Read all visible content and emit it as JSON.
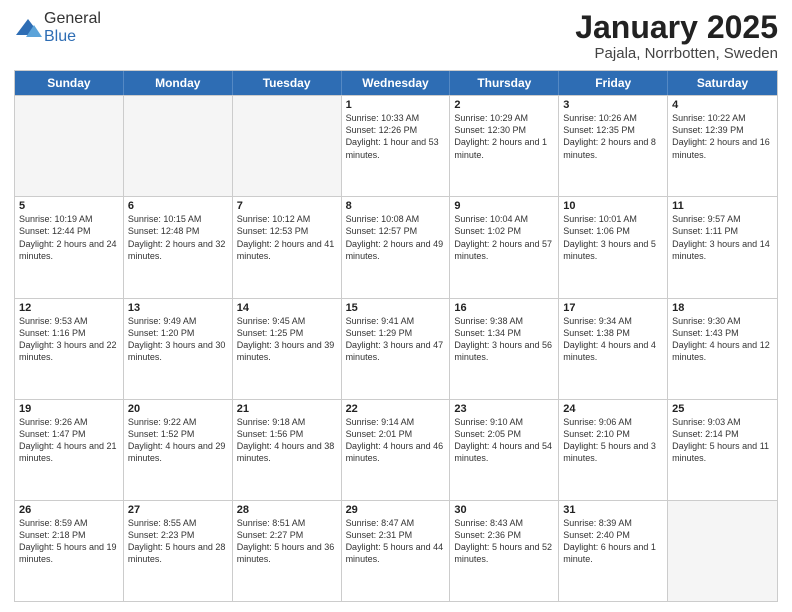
{
  "header": {
    "logo_general": "General",
    "logo_blue": "Blue",
    "month_title": "January 2025",
    "location": "Pajala, Norrbotten, Sweden"
  },
  "weekdays": [
    "Sunday",
    "Monday",
    "Tuesday",
    "Wednesday",
    "Thursday",
    "Friday",
    "Saturday"
  ],
  "weeks": [
    [
      {
        "day": "",
        "empty": true
      },
      {
        "day": "",
        "empty": true
      },
      {
        "day": "",
        "empty": true
      },
      {
        "day": "1",
        "info": "Sunrise: 10:33 AM\nSunset: 12:26 PM\nDaylight: 1 hour and\n53 minutes."
      },
      {
        "day": "2",
        "info": "Sunrise: 10:29 AM\nSunset: 12:30 PM\nDaylight: 2 hours\nand 1 minute."
      },
      {
        "day": "3",
        "info": "Sunrise: 10:26 AM\nSunset: 12:35 PM\nDaylight: 2 hours\nand 8 minutes."
      },
      {
        "day": "4",
        "info": "Sunrise: 10:22 AM\nSunset: 12:39 PM\nDaylight: 2 hours\nand 16 minutes."
      }
    ],
    [
      {
        "day": "5",
        "info": "Sunrise: 10:19 AM\nSunset: 12:44 PM\nDaylight: 2 hours\nand 24 minutes."
      },
      {
        "day": "6",
        "info": "Sunrise: 10:15 AM\nSunset: 12:48 PM\nDaylight: 2 hours\nand 32 minutes."
      },
      {
        "day": "7",
        "info": "Sunrise: 10:12 AM\nSunset: 12:53 PM\nDaylight: 2 hours\nand 41 minutes."
      },
      {
        "day": "8",
        "info": "Sunrise: 10:08 AM\nSunset: 12:57 PM\nDaylight: 2 hours\nand 49 minutes."
      },
      {
        "day": "9",
        "info": "Sunrise: 10:04 AM\nSunset: 1:02 PM\nDaylight: 2 hours\nand 57 minutes."
      },
      {
        "day": "10",
        "info": "Sunrise: 10:01 AM\nSunset: 1:06 PM\nDaylight: 3 hours\nand 5 minutes."
      },
      {
        "day": "11",
        "info": "Sunrise: 9:57 AM\nSunset: 1:11 PM\nDaylight: 3 hours\nand 14 minutes."
      }
    ],
    [
      {
        "day": "12",
        "info": "Sunrise: 9:53 AM\nSunset: 1:16 PM\nDaylight: 3 hours\nand 22 minutes."
      },
      {
        "day": "13",
        "info": "Sunrise: 9:49 AM\nSunset: 1:20 PM\nDaylight: 3 hours\nand 30 minutes."
      },
      {
        "day": "14",
        "info": "Sunrise: 9:45 AM\nSunset: 1:25 PM\nDaylight: 3 hours\nand 39 minutes."
      },
      {
        "day": "15",
        "info": "Sunrise: 9:41 AM\nSunset: 1:29 PM\nDaylight: 3 hours\nand 47 minutes."
      },
      {
        "day": "16",
        "info": "Sunrise: 9:38 AM\nSunset: 1:34 PM\nDaylight: 3 hours\nand 56 minutes."
      },
      {
        "day": "17",
        "info": "Sunrise: 9:34 AM\nSunset: 1:38 PM\nDaylight: 4 hours\nand 4 minutes."
      },
      {
        "day": "18",
        "info": "Sunrise: 9:30 AM\nSunset: 1:43 PM\nDaylight: 4 hours\nand 12 minutes."
      }
    ],
    [
      {
        "day": "19",
        "info": "Sunrise: 9:26 AM\nSunset: 1:47 PM\nDaylight: 4 hours\nand 21 minutes."
      },
      {
        "day": "20",
        "info": "Sunrise: 9:22 AM\nSunset: 1:52 PM\nDaylight: 4 hours\nand 29 minutes."
      },
      {
        "day": "21",
        "info": "Sunrise: 9:18 AM\nSunset: 1:56 PM\nDaylight: 4 hours\nand 38 minutes."
      },
      {
        "day": "22",
        "info": "Sunrise: 9:14 AM\nSunset: 2:01 PM\nDaylight: 4 hours\nand 46 minutes."
      },
      {
        "day": "23",
        "info": "Sunrise: 9:10 AM\nSunset: 2:05 PM\nDaylight: 4 hours\nand 54 minutes."
      },
      {
        "day": "24",
        "info": "Sunrise: 9:06 AM\nSunset: 2:10 PM\nDaylight: 5 hours\nand 3 minutes."
      },
      {
        "day": "25",
        "info": "Sunrise: 9:03 AM\nSunset: 2:14 PM\nDaylight: 5 hours\nand 11 minutes."
      }
    ],
    [
      {
        "day": "26",
        "info": "Sunrise: 8:59 AM\nSunset: 2:18 PM\nDaylight: 5 hours\nand 19 minutes."
      },
      {
        "day": "27",
        "info": "Sunrise: 8:55 AM\nSunset: 2:23 PM\nDaylight: 5 hours\nand 28 minutes."
      },
      {
        "day": "28",
        "info": "Sunrise: 8:51 AM\nSunset: 2:27 PM\nDaylight: 5 hours\nand 36 minutes."
      },
      {
        "day": "29",
        "info": "Sunrise: 8:47 AM\nSunset: 2:31 PM\nDaylight: 5 hours\nand 44 minutes."
      },
      {
        "day": "30",
        "info": "Sunrise: 8:43 AM\nSunset: 2:36 PM\nDaylight: 5 hours\nand 52 minutes."
      },
      {
        "day": "31",
        "info": "Sunrise: 8:39 AM\nSunset: 2:40 PM\nDaylight: 6 hours\nand 1 minute."
      },
      {
        "day": "",
        "empty": true
      }
    ]
  ]
}
